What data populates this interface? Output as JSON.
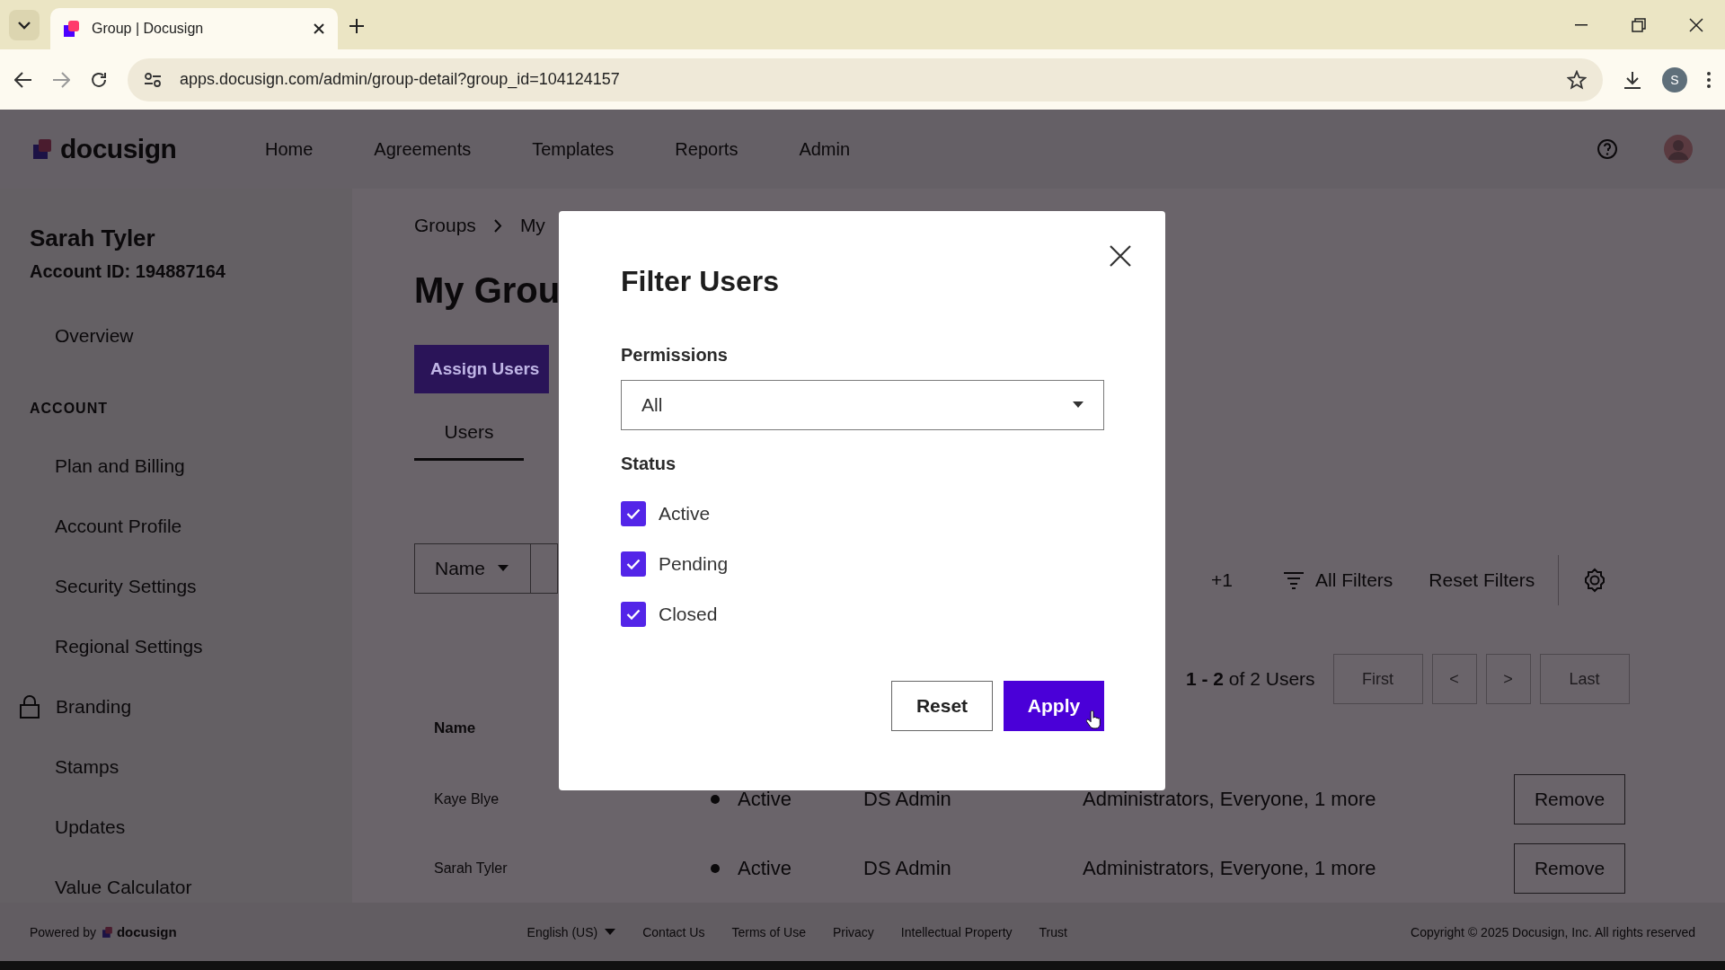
{
  "browser": {
    "tab_title": "Group | Docusign",
    "url": "apps.docusign.com/admin/group-detail?group_id=104124157",
    "profile_initial": "S"
  },
  "header": {
    "logo": "docusign",
    "nav": [
      {
        "label": "Home"
      },
      {
        "label": "Agreements"
      },
      {
        "label": "Templates"
      },
      {
        "label": "Reports"
      },
      {
        "label": "Admin"
      }
    ]
  },
  "sidebar": {
    "user_name": "Sarah Tyler",
    "account_id": "Account ID: 194887164",
    "items": [
      {
        "kind": "item",
        "label": "Overview"
      },
      {
        "kind": "heading",
        "label": "ACCOUNT"
      },
      {
        "kind": "item",
        "label": "Plan and Billing"
      },
      {
        "kind": "item",
        "label": "Account Profile"
      },
      {
        "kind": "item",
        "label": "Security Settings"
      },
      {
        "kind": "item",
        "label": "Regional Settings"
      },
      {
        "kind": "locked_item",
        "label": "Branding"
      },
      {
        "kind": "item",
        "label": "Stamps"
      },
      {
        "kind": "item",
        "label": "Updates"
      },
      {
        "kind": "item",
        "label": "Value Calculator"
      }
    ]
  },
  "main": {
    "breadcrumb": [
      "Groups",
      "My"
    ],
    "title": "My Grou",
    "assign_button": "Assign Users",
    "tabs": [
      {
        "label": "Users",
        "selected": true
      }
    ],
    "search_by": "Name",
    "filter_count": "+1",
    "all_filters": "All Filters",
    "reset_filters": "Reset Filters",
    "summary": "**1 - 2** of 2 Users",
    "pages": [
      "First",
      "<",
      ">",
      "Last"
    ]
  },
  "table": {
    "columns": [
      "Name"
    ],
    "rows": [
      {
        "name": "Kaye Blye",
        "status": "Active",
        "permission": "DS Admin",
        "groups": "Administrators, Everyone, 1 more",
        "action": "Remove"
      },
      {
        "name": "Sarah Tyler",
        "status": "Active",
        "permission": "DS Admin",
        "groups": "Administrators, Everyone, 1 more",
        "action": "Remove"
      }
    ]
  },
  "modal": {
    "title": "Filter Users",
    "permissions_label": "Permissions",
    "permissions_value": "All",
    "status_label": "Status",
    "statuses": [
      {
        "label": "Active",
        "checked": true
      },
      {
        "label": "Pending",
        "checked": true
      },
      {
        "label": "Closed",
        "checked": true
      }
    ],
    "buttons": [
      {
        "label": "Reset",
        "kind": "secondary"
      },
      {
        "label": "Apply",
        "kind": "primary"
      }
    ]
  },
  "footer": {
    "powered_by": "Powered by",
    "logo": "docusign",
    "language": "English (US)",
    "links": [
      "Contact Us",
      "Terms of Use",
      "Privacy",
      "Intellectual Property",
      "Trust"
    ],
    "copyright": "Copyright © 2025 Docusign, Inc. All rights reserved"
  }
}
